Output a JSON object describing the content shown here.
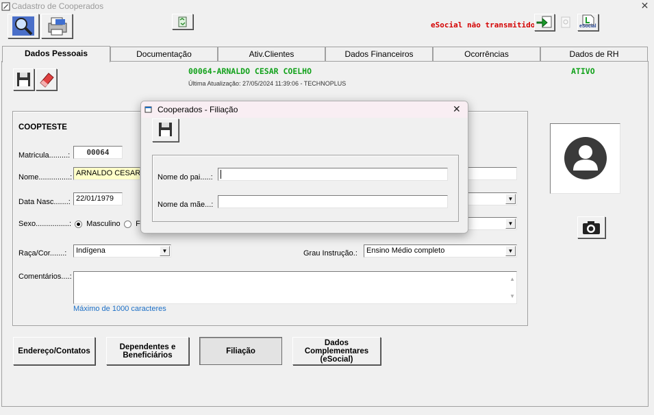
{
  "window": {
    "title": "Cadastro de Cooperados",
    "close": "✕"
  },
  "toolbar": {
    "esocial_status": "eSocial não transmitido",
    "esocial_icon_label": "eSocial"
  },
  "tabs": [
    {
      "label": "Dados Pessoais"
    },
    {
      "label": "Documentação"
    },
    {
      "label": "Ativ.Clientes"
    },
    {
      "label": "Dados Financeiros"
    },
    {
      "label": "Ocorrências"
    },
    {
      "label": "Dados de RH"
    }
  ],
  "record": {
    "header": "00064-ARNALDO CESAR COELHO",
    "status": "ATIVO",
    "last_update": "Última Atualização: 27/05/2024 11:39:06 - TECHNOPLUS"
  },
  "form": {
    "group_title": "COOPTESTE",
    "matricula_label": "Matricula.........:",
    "matricula_value": "00064",
    "nome_label": "Nome...............:",
    "nome_value": "ARNALDO CESAR",
    "data_nasc_label": "Data Nasc.......:",
    "data_nasc_value": "22/01/1979",
    "sexo_label": "Sexo................:",
    "sexo_masc": "Masculino",
    "sexo_fem": "F",
    "raca_label": "Raça/Cor.......:",
    "raca_value": "Indígena",
    "grau_label": "Grau Instrução.:",
    "grau_value": "Ensino Médio completo",
    "comentarios_label": "Comentários....:",
    "comentarios_note": "Máximo de 1000 caracteres"
  },
  "buttons": {
    "endereco": "Endereço/Contatos",
    "dependentes_l1": "Dependentes e",
    "dependentes_l2": "Beneficiários",
    "filiacao": "Filiação",
    "dados_l1": "Dados",
    "dados_l2": "Complementares",
    "dados_l3": "(eSocial)"
  },
  "dialog": {
    "title": "Cooperados - Filiação",
    "close": "✕",
    "pai_label": "Nome do pai.....:",
    "pai_value": "",
    "mae_label": "Nome da mãe...:",
    "mae_value": ""
  },
  "colors": {
    "accent_green": "#11a11a",
    "status_red": "#d40000",
    "note_blue": "#1c6fc6"
  }
}
